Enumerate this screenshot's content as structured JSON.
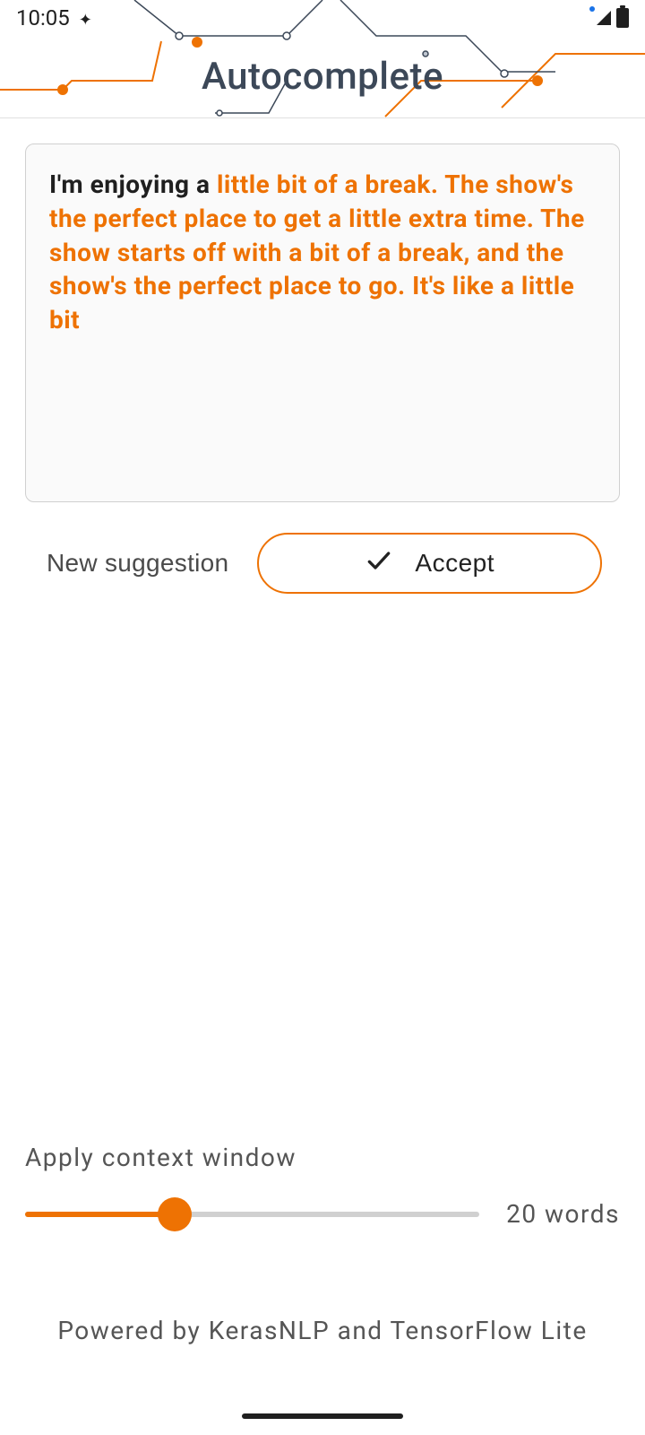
{
  "status": {
    "time": "10:05"
  },
  "header": {
    "title": "Autocomplete"
  },
  "input": {
    "prefix": "I'm enjoying a ",
    "suggestion": "little bit of a break. The show's the perfect place to get a little extra time. The show starts off with a bit of a break, and the show's the perfect place to go. It's like a little bit"
  },
  "buttons": {
    "new_suggestion": "New suggestion",
    "accept": "Accept"
  },
  "slider": {
    "label": "Apply context window",
    "value_text": "20 words",
    "value": 20,
    "percent": 33
  },
  "footer": {
    "text": "Powered by KerasNLP and TensorFlow Lite"
  },
  "colors": {
    "accent": "#ee7203",
    "title": "#3c4858"
  }
}
